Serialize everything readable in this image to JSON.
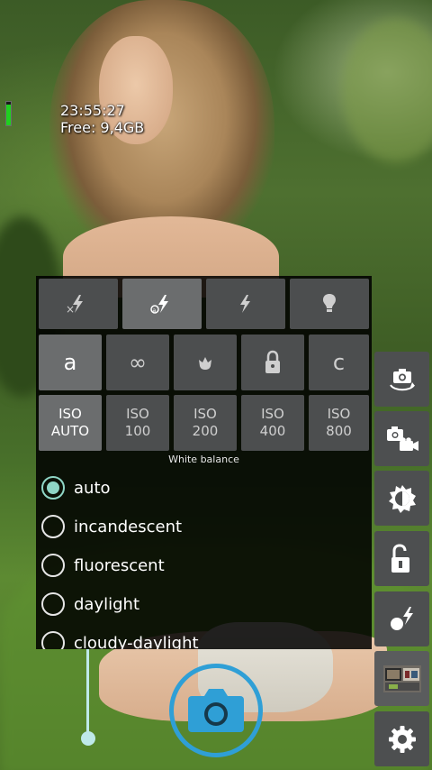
{
  "osd": {
    "time": "23:55:27",
    "free": "Free: 9,4GB",
    "battery_level": 0.9
  },
  "flash_modes": [
    {
      "icon": "flash-off-icon",
      "selected": false
    },
    {
      "icon": "flash-auto-icon",
      "selected": true
    },
    {
      "icon": "flash-on-icon",
      "selected": false
    },
    {
      "icon": "torch-icon",
      "selected": false
    }
  ],
  "focus_modes": [
    {
      "label": "a",
      "icon": "focus-auto-icon",
      "selected": true
    },
    {
      "label": "∞",
      "icon": "focus-infinity-icon",
      "selected": false
    },
    {
      "label": "",
      "icon": "focus-macro-icon",
      "selected": false
    },
    {
      "label": "",
      "icon": "focus-locked-icon",
      "selected": false
    },
    {
      "label": "c",
      "icon": "focus-continuous-icon",
      "selected": false
    }
  ],
  "iso": [
    {
      "line1": "ISO",
      "line2": "AUTO",
      "selected": true
    },
    {
      "line1": "ISO",
      "line2": "100",
      "selected": false
    },
    {
      "line1": "ISO",
      "line2": "200",
      "selected": false
    },
    {
      "line1": "ISO",
      "line2": "400",
      "selected": false
    },
    {
      "line1": "ISO",
      "line2": "800",
      "selected": false
    }
  ],
  "white_balance": {
    "title": "White balance",
    "options": [
      {
        "label": "auto",
        "selected": true
      },
      {
        "label": "incandescent",
        "selected": false
      },
      {
        "label": "fluorescent",
        "selected": false
      },
      {
        "label": "daylight",
        "selected": false
      },
      {
        "label": "cloudy-daylight",
        "selected": false
      }
    ]
  },
  "side_toolbar": [
    "switch-camera-icon",
    "photo-video-mode-icon",
    "exposure-icon",
    "exposure-lock-icon",
    "flash-popup-icon",
    "gallery-thumbnail-icon",
    "settings-gear-icon"
  ],
  "colors": {
    "accent": "#2f9fd6",
    "radio_selected": "#8fd6c6",
    "zoom_slider": "#bfe9ea"
  }
}
